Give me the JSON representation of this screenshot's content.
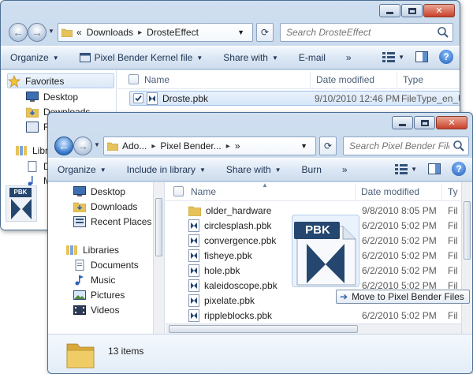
{
  "back_window": {
    "breadcrumb": [
      "«",
      "Downloads",
      "DrosteEffect"
    ],
    "search_placeholder": "Search DrosteEffect",
    "commands": [
      "Organize",
      "Pixel Bender Kernel file",
      "Share with",
      "E-mail",
      "»"
    ],
    "columns": [
      "Name",
      "Date modified",
      "Type"
    ],
    "nav_items": [
      "Favorites",
      "Desktop",
      "Downloads",
      "R",
      "Libr",
      "D",
      "M"
    ],
    "files": [
      {
        "name": "Droste.pbk",
        "date": "9/10/2010 12:46 PM",
        "type": "FileType_en_U"
      }
    ],
    "icon_label": "PBK"
  },
  "front_window": {
    "breadcrumb": [
      "Ado...",
      "Pixel Bender...",
      "»"
    ],
    "search_placeholder": "Search Pixel Bender Files",
    "commands": [
      "Organize",
      "Include in library",
      "Share with",
      "Burn",
      "»"
    ],
    "columns": [
      "Name",
      "Date modified",
      "Ty"
    ],
    "nav_favorites": [
      "Desktop",
      "Downloads",
      "Recent Places"
    ],
    "nav_libraries_header": "Libraries",
    "nav_libraries": [
      "Documents",
      "Music",
      "Pictures",
      "Videos"
    ],
    "files": [
      {
        "name": "older_hardware",
        "date": "9/8/2010 8:05 PM",
        "type": "Fil",
        "kind": "folder"
      },
      {
        "name": "circlesplash.pbk",
        "date": "6/2/2010 5:02 PM",
        "type": "Fil",
        "kind": "pbk"
      },
      {
        "name": "convergence.pbk",
        "date": "6/2/2010 5:02 PM",
        "type": "Fil",
        "kind": "pbk"
      },
      {
        "name": "fisheye.pbk",
        "date": "6/2/2010 5:02 PM",
        "type": "Fil",
        "kind": "pbk"
      },
      {
        "name": "hole.pbk",
        "date": "6/2/2010 5:02 PM",
        "type": "Fil",
        "kind": "pbk"
      },
      {
        "name": "kaleidoscope.pbk",
        "date": "6/2/2010 5:02 PM",
        "type": "Fil",
        "kind": "pbk"
      },
      {
        "name": "pixelate.pbk",
        "date": "6/2/2010 5:02 PM",
        "type": "Fil",
        "kind": "pbk"
      },
      {
        "name": "rippleblocks.pbk",
        "date": "6/2/2010 5:02 PM",
        "type": "Fil",
        "kind": "pbk"
      }
    ],
    "item_count": "13 items",
    "drag_label": "PBK",
    "drag_tooltip": "Move to Pixel Bender Files"
  },
  "colors": {
    "frame": "#b5cbe3",
    "close_red": "#c9412a",
    "back_button_blue": "#2f74c9",
    "pbk_badge": "#25466e"
  }
}
